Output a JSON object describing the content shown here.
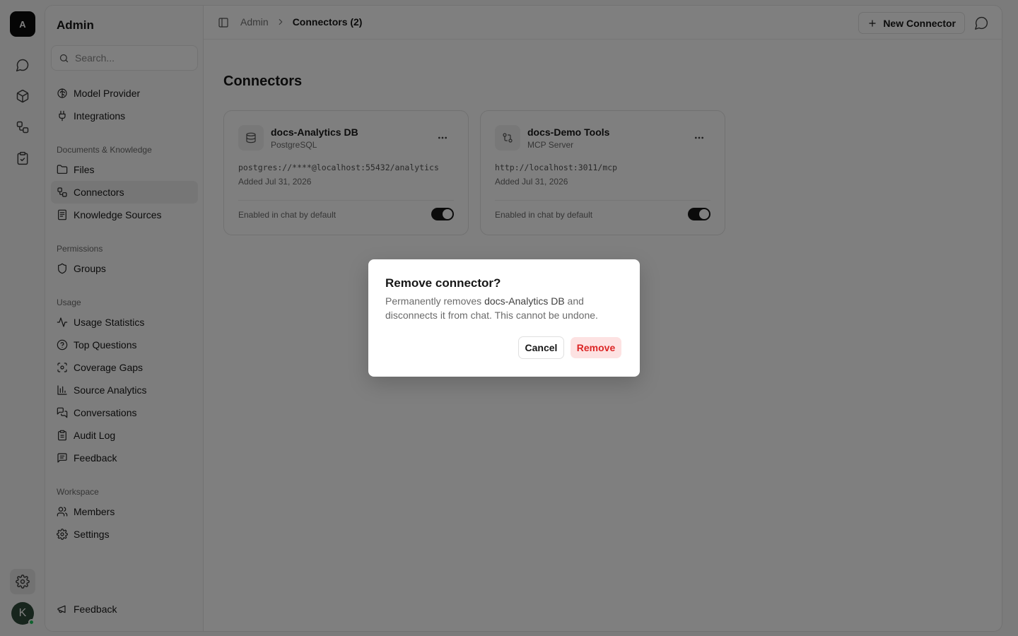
{
  "rail": {
    "logo": "A",
    "avatar": "K",
    "icons": [
      "chat-icon",
      "cube-icon",
      "connectors-icon",
      "clipboard-check-icon",
      "gear-icon"
    ]
  },
  "sidebar": {
    "title": "Admin",
    "search_placeholder": "Search...",
    "top_items": [
      {
        "label": "Model Provider",
        "icon": "brain-icon"
      },
      {
        "label": "Integrations",
        "icon": "plug-icon"
      }
    ],
    "sections": [
      {
        "title": "Documents & Knowledge",
        "items": [
          {
            "label": "Files",
            "icon": "folder-icon"
          },
          {
            "label": "Connectors",
            "icon": "connectors-icon",
            "active": true
          },
          {
            "label": "Knowledge Sources",
            "icon": "book-icon"
          }
        ]
      },
      {
        "title": "Permissions",
        "items": [
          {
            "label": "Groups",
            "icon": "shield-icon"
          }
        ]
      },
      {
        "title": "Usage",
        "items": [
          {
            "label": "Usage Statistics",
            "icon": "activity-icon"
          },
          {
            "label": "Top Questions",
            "icon": "help-circle-icon"
          },
          {
            "label": "Coverage Gaps",
            "icon": "scan-icon"
          },
          {
            "label": "Source Analytics",
            "icon": "bar-chart-icon"
          },
          {
            "label": "Conversations",
            "icon": "messages-icon"
          },
          {
            "label": "Audit Log",
            "icon": "clipboard-icon"
          },
          {
            "label": "Feedback",
            "icon": "message-square-icon"
          }
        ]
      },
      {
        "title": "Workspace",
        "items": [
          {
            "label": "Members",
            "icon": "users-icon"
          },
          {
            "label": "Settings",
            "icon": "gear-icon"
          }
        ]
      }
    ],
    "footer_item": {
      "label": "Feedback",
      "icon": "megaphone-icon"
    }
  },
  "header": {
    "breadcrumb_root": "Admin",
    "breadcrumb_current": "Connectors (2)",
    "new_button": "New Connector"
  },
  "main": {
    "title": "Connectors",
    "cards": [
      {
        "name": "docs-Analytics DB",
        "type": "PostgreSQL",
        "url": "postgres://****@localhost:55432/analytics",
        "added": "Added Jul 31, 2026",
        "enabled_label": "Enabled in chat by default",
        "enabled": true,
        "icon": "database-icon"
      },
      {
        "name": "docs-Demo Tools",
        "type": "MCP Server",
        "url": "http://localhost:3011/mcp",
        "added": "Added Jul 31, 2026",
        "enabled_label": "Enabled in chat by default",
        "enabled": true,
        "icon": "git-compare-icon"
      }
    ]
  },
  "dialog": {
    "title": "Remove connector?",
    "body_prefix": "Permanently removes ",
    "body_name": "docs-Analytics DB",
    "body_suffix": " and disconnects it from chat. This cannot be undone.",
    "cancel": "Cancel",
    "remove": "Remove"
  },
  "colors": {
    "accent": "#171717",
    "danger": "#dc2626",
    "danger_bg": "#fde2e2",
    "overlay": "rgba(0,0,0,0.5)"
  }
}
